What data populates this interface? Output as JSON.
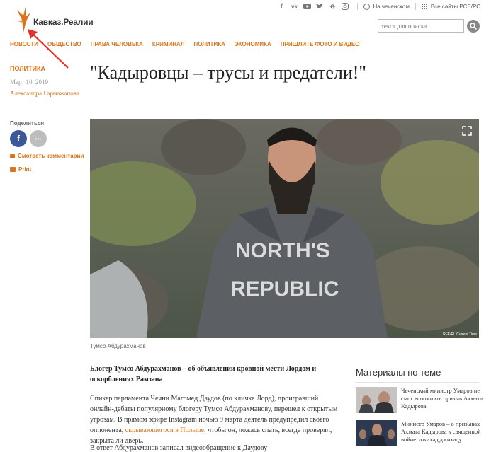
{
  "brand": {
    "name": "Кавказ.Реалии",
    "accent": "#d9751c"
  },
  "topbar": {
    "social_icons": [
      "facebook-icon",
      "vk-icon",
      "youtube-icon",
      "twitter-icon",
      "odnoklassniki-icon",
      "instagram-icon"
    ],
    "language_link": "На чеченском",
    "sites_link": "Все сайты РСЕ/РС"
  },
  "search": {
    "placeholder": "текст для поиска..."
  },
  "nav": [
    "НОВОСТИ",
    "ОБЩЕСТВО",
    "ПРАВА ЧЕЛОВЕКА",
    "КРИМИНАЛ",
    "ПОЛИТИКА",
    "ЭКОНОМИКА",
    "ПРИШЛИТЕ ФОТО И ВИДЕО"
  ],
  "article": {
    "category": "ПОЛИТИКА",
    "date": "Март 10, 2019",
    "author": "Александра Гармажапова",
    "headline": "\"Кадыровцы – трусы и предатели!\"",
    "share_label": "Поделиться",
    "comments_label": "Смотреть комментарии",
    "print_label": "Print",
    "photo_credit": "RFE/RL Current Time",
    "photo_caption": "Тумсо Абдурахманов",
    "hoodie_line1": "NORTH'S",
    "hoodie_line2": "REPUBLIC",
    "lead": "Блогер Тумсо Абдурахманов – об объявлении кровной мести Лордом и оскорблениях Рамзана",
    "body_before_link": "Спикер парламента Чечни Магомед Даудов (по кличке Лорд), проигравший онлайн-дебаты популярному блогеру Тумсо Абдурахманову, перешел к открытым угрозам. В прямом эфире Instagram ночью 9 марта деятель предупредил своего оппонента, ",
    "body_link": "скрывающегося в Польше",
    "body_after_link": ", чтобы он, ложась спать, всегда проверял, закрыта ли дверь.",
    "body2": "В ответ Абдурахманов записал видеообращение к Даудову"
  },
  "related": {
    "title": "Материалы по теме",
    "items": [
      {
        "text": "Чеченский министр Умаров не смог вспомнить призыв Ахмата Кадырова"
      },
      {
        "text": "Министр Умаров – о призывах Ахмата Кадырова к священной войне: джихад джихаду"
      }
    ]
  }
}
